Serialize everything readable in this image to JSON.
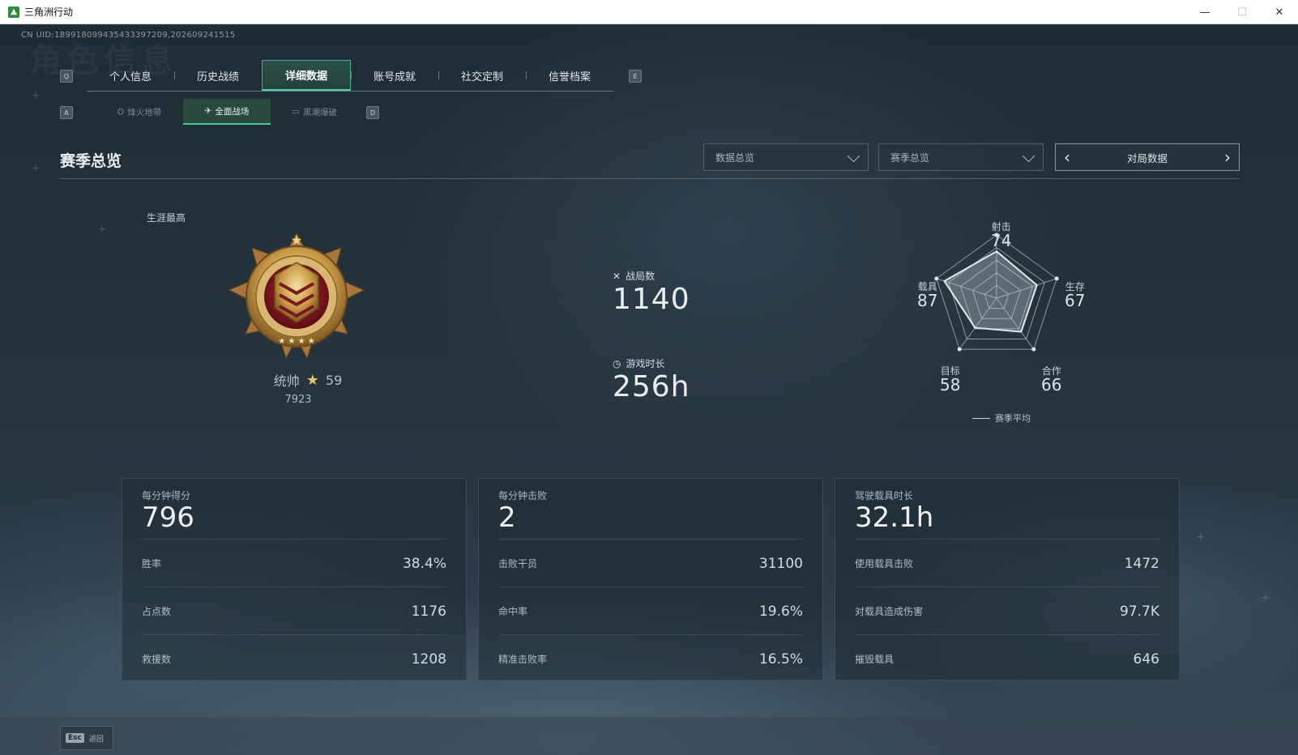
{
  "window": {
    "title": "三角洲行动",
    "minimize": "—",
    "maximize": "☐",
    "close": "✕"
  },
  "uid": "CN UID:189918099435433397209,202609241515",
  "bg_title": "角色信息",
  "keys": {
    "q": "Q",
    "e": "E",
    "a": "A",
    "d": "D"
  },
  "tabs": [
    {
      "label": "个人信息",
      "active": false
    },
    {
      "label": "历史战绩",
      "active": false
    },
    {
      "label": "详细数据",
      "active": true
    },
    {
      "label": "账号成就",
      "active": false
    },
    {
      "label": "社交定制",
      "active": false
    },
    {
      "label": "信誉档案",
      "active": false
    }
  ],
  "subtabs": [
    {
      "label": "烽火地带",
      "icon": "fire-zone-icon",
      "active": false
    },
    {
      "label": "全面战场",
      "icon": "full-battlefield-icon",
      "active": true
    },
    {
      "label": "黑潮爆破",
      "icon": "blackout-icon",
      "active": false
    }
  ],
  "section_title": "赛季总览",
  "filters": {
    "data_select": "数据总览",
    "season_select": "赛季总览",
    "pager_label": "对局数据"
  },
  "career": {
    "label": "生涯最高",
    "rank_name": "统帅",
    "stars": "59",
    "score": "7923"
  },
  "stats": {
    "matches": {
      "label": "战局数",
      "value": "1140"
    },
    "playtime": {
      "label": "游戏时长",
      "value": "256h"
    }
  },
  "radar": {
    "axes": [
      {
        "label": "射击",
        "value": 74
      },
      {
        "label": "生存",
        "value": 67
      },
      {
        "label": "合作",
        "value": 66
      },
      {
        "label": "目标",
        "value": 58
      },
      {
        "label": "载具",
        "value": 87
      }
    ],
    "legend": "赛季平均"
  },
  "cards": [
    {
      "head_label": "每分钟得分",
      "head_value": "796",
      "rows": [
        {
          "k": "胜率",
          "v": "38.4%"
        },
        {
          "k": "占点数",
          "v": "1176"
        },
        {
          "k": "救援数",
          "v": "1208"
        }
      ]
    },
    {
      "head_label": "每分钟击败",
      "head_value": "2",
      "rows": [
        {
          "k": "击败干员",
          "v": "31100"
        },
        {
          "k": "命中率",
          "v": "19.6%"
        },
        {
          "k": "精准击败率",
          "v": "16.5%"
        }
      ]
    },
    {
      "head_label": "驾驶载具时长",
      "head_value": "32.1h",
      "rows": [
        {
          "k": "使用载具击败",
          "v": "1472"
        },
        {
          "k": "对载具造成伤害",
          "v": "97.7K"
        },
        {
          "k": "摧毁载具",
          "v": "646"
        }
      ]
    }
  ],
  "footer": {
    "esc_key": "Esc",
    "back_label": "返回"
  }
}
